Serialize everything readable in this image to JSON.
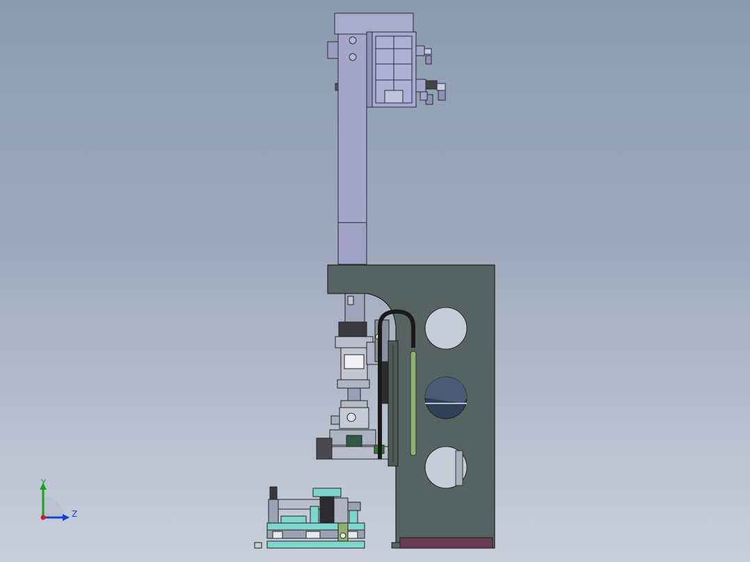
{
  "viewport": {
    "background_top": "#8b9bb0",
    "background_bottom": "#c9d0dc"
  },
  "model": {
    "description_visible": false,
    "colors": {
      "frame": "#556460",
      "column": "#a4a7c9",
      "edge": "#2a2a3a",
      "base_pad": "#6a3a52",
      "fixture_cyan": "#7fd6cf",
      "guide_green": "#8fb070",
      "hose": "#1a1a1a"
    }
  },
  "triad": {
    "y_label": "Y",
    "z_label": "Z",
    "y_color": "#1aa31a",
    "z_color": "#1f3fcf",
    "origin_color": "#d02020"
  }
}
